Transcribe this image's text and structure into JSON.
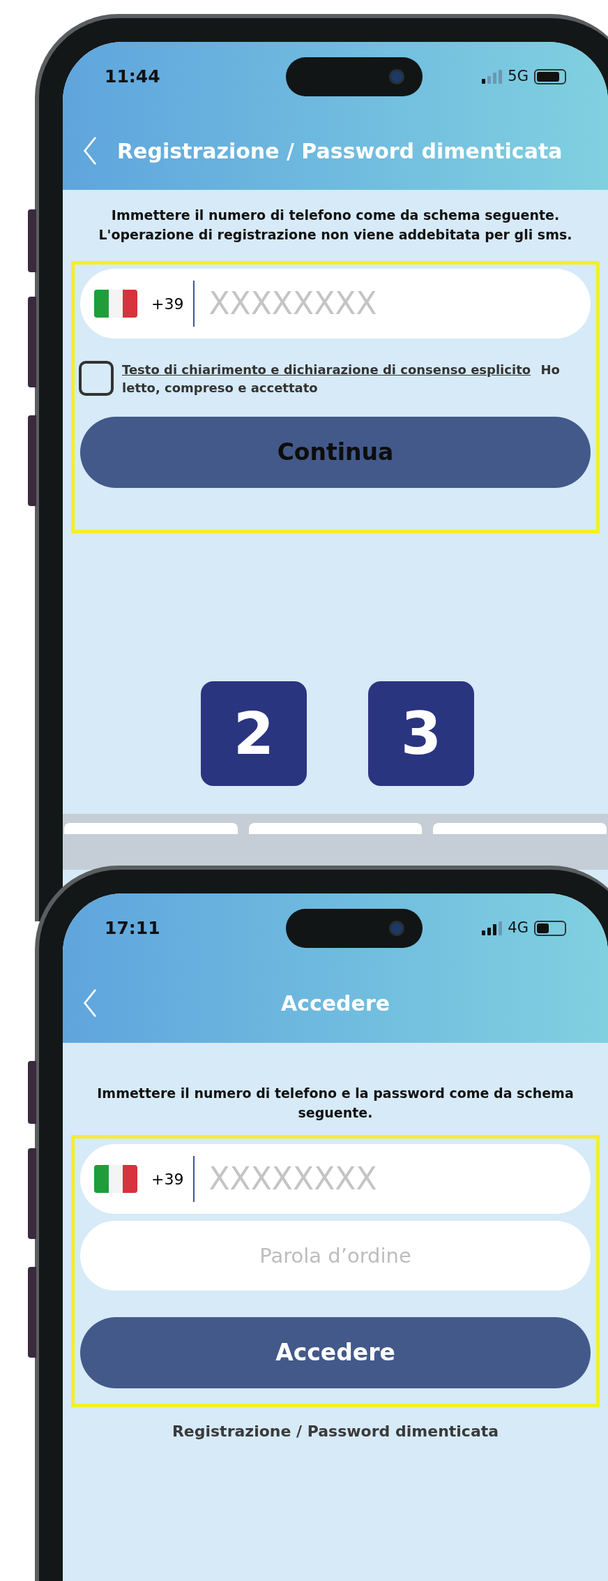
{
  "screens": [
    {
      "status_bar": {
        "time": "11:44",
        "network": "5G"
      },
      "header": {
        "title": "Registrazione / Password dimenticata",
        "centered": false
      },
      "instruction": "Immettere il numero di telefono come da schema seguente. L'operazione di registrazione non viene addebitata per gli sms.",
      "phone_field": {
        "country_code": "+39",
        "placeholder": "XXXXXXXX"
      },
      "consent": {
        "checked": false,
        "link": "Testo di chiarimento e dichiarazione di consenso esplicito",
        "text": "Ho letto, compreso e accettato"
      },
      "button": "Continua",
      "step_badges": [
        "2",
        "3"
      ]
    },
    {
      "status_bar": {
        "time": "17:11",
        "network": "4G"
      },
      "header": {
        "title": "Accedere",
        "centered": true
      },
      "instruction": "Immettere il numero di telefono e la password come da schema seguente.",
      "phone_field": {
        "country_code": "+39",
        "placeholder": "XXXXXXXX"
      },
      "password_field": {
        "placeholder": "Parola d’ordine"
      },
      "button": "Accedere",
      "link": "Registrazione / Password dimenticata"
    }
  ]
}
